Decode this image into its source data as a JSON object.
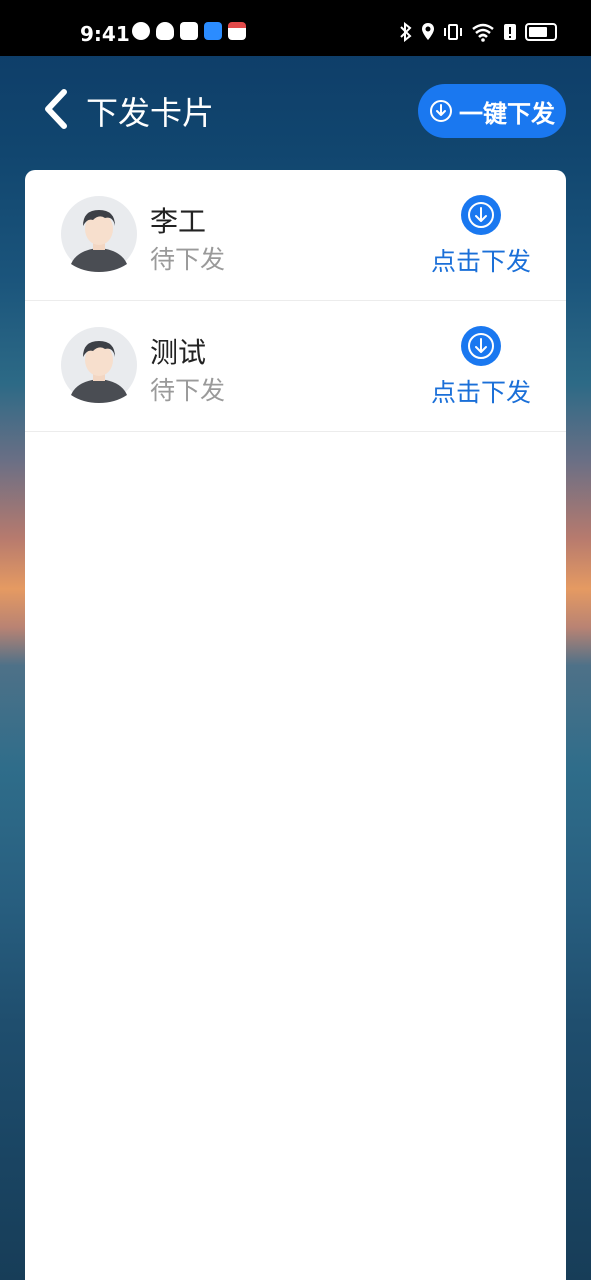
{
  "status_bar": {
    "time": "9:41"
  },
  "header": {
    "title": "下发卡片",
    "one_key_label": "一键下发"
  },
  "cards": [
    {
      "name": "李工",
      "status": "待下发",
      "action_label": "点击下发"
    },
    {
      "name": "测试",
      "status": "待下发",
      "action_label": "点击下发"
    }
  ],
  "colors": {
    "accent": "#1a78f0",
    "action_text": "#1a6fd8",
    "status_text": "#9a9a9a",
    "card_bg": "#ffffff"
  },
  "icons": {
    "back": "chevron-left-icon",
    "download": "download-circle-icon",
    "avatar": "user-avatar-icon"
  }
}
